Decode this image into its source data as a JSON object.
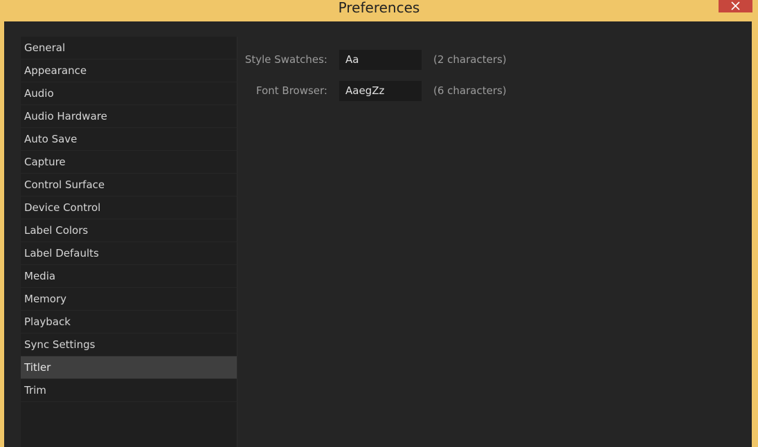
{
  "window": {
    "title": "Preferences",
    "close_icon": "close-icon",
    "titlebar_color": "#f0c668",
    "close_color": "#c7473d"
  },
  "sidebar": {
    "items": [
      {
        "label": "General"
      },
      {
        "label": "Appearance"
      },
      {
        "label": "Audio"
      },
      {
        "label": "Audio Hardware"
      },
      {
        "label": "Auto Save"
      },
      {
        "label": "Capture"
      },
      {
        "label": "Control Surface"
      },
      {
        "label": "Device Control"
      },
      {
        "label": "Label Colors"
      },
      {
        "label": "Label Defaults"
      },
      {
        "label": "Media"
      },
      {
        "label": "Memory"
      },
      {
        "label": "Playback"
      },
      {
        "label": "Sync Settings"
      },
      {
        "label": "Titler",
        "selected": true
      },
      {
        "label": "Trim"
      }
    ]
  },
  "titler": {
    "style_swatches": {
      "label": "Style Swatches:",
      "value": "Aa",
      "hint": "(2 characters)"
    },
    "font_browser": {
      "label": "Font Browser:",
      "value": "AaegZz",
      "hint": "(6 characters)"
    }
  }
}
